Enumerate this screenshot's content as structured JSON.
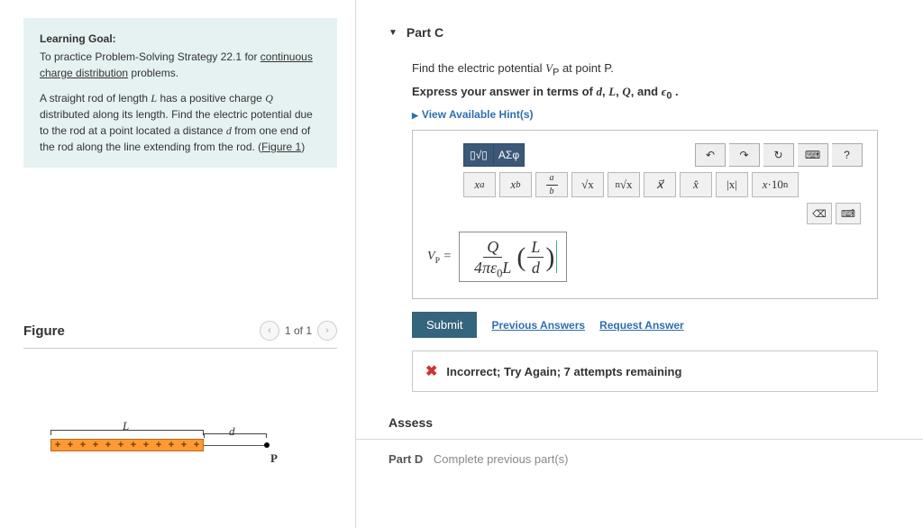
{
  "left": {
    "goal_label": "Learning Goal:",
    "goal_text_a": "To practice Problem-Solving Strategy 22.1 for ",
    "goal_link": "continuous charge distribution",
    "goal_text_b": " problems.",
    "problem_html": "A straight rod of length L has a positive charge Q distributed along its length. Find the electric potential due to the rod at a point located a distance d from one end of the rod along the line extending from the rod. (Figure 1)",
    "fig_link": "Figure 1",
    "figure_label": "Figure",
    "fig_page": "1 of 1",
    "lbl_L": "L",
    "lbl_d": "d",
    "lbl_P": "P"
  },
  "part": {
    "title": "Part C",
    "prompt_a": "Find the electric potential ",
    "prompt_b": " at point P.",
    "vp_sym": "V",
    "vp_sub": "P",
    "express": "Express your answer in terms of d, L, Q, and ϵ₀ .",
    "hints": "View Available Hint(s)",
    "answer_label": "VP =",
    "toolbar": {
      "greek": "ΑΣφ",
      "undo": "↶",
      "redo": "↷",
      "reset": "↻",
      "kbd": "⌨",
      "help": "?",
      "row2": [
        "xᵃ",
        "xᵦ",
        "a/b",
        "√x",
        "ⁿ√x",
        "x⃗",
        "x̂",
        "|x|",
        "x·10ⁿ"
      ],
      "backspace": "⌫",
      "keys": "⌨"
    },
    "answer": {
      "num1": "Q",
      "den1": "4πε₀L",
      "num2": "L",
      "den2": "d"
    },
    "submit": "Submit",
    "prev": "Previous Answers",
    "request": "Request Answer",
    "feedback": "Incorrect; Try Again; 7 attempts remaining"
  },
  "assess": "Assess",
  "partD": {
    "label": "Part D",
    "text": "Complete previous part(s)"
  }
}
